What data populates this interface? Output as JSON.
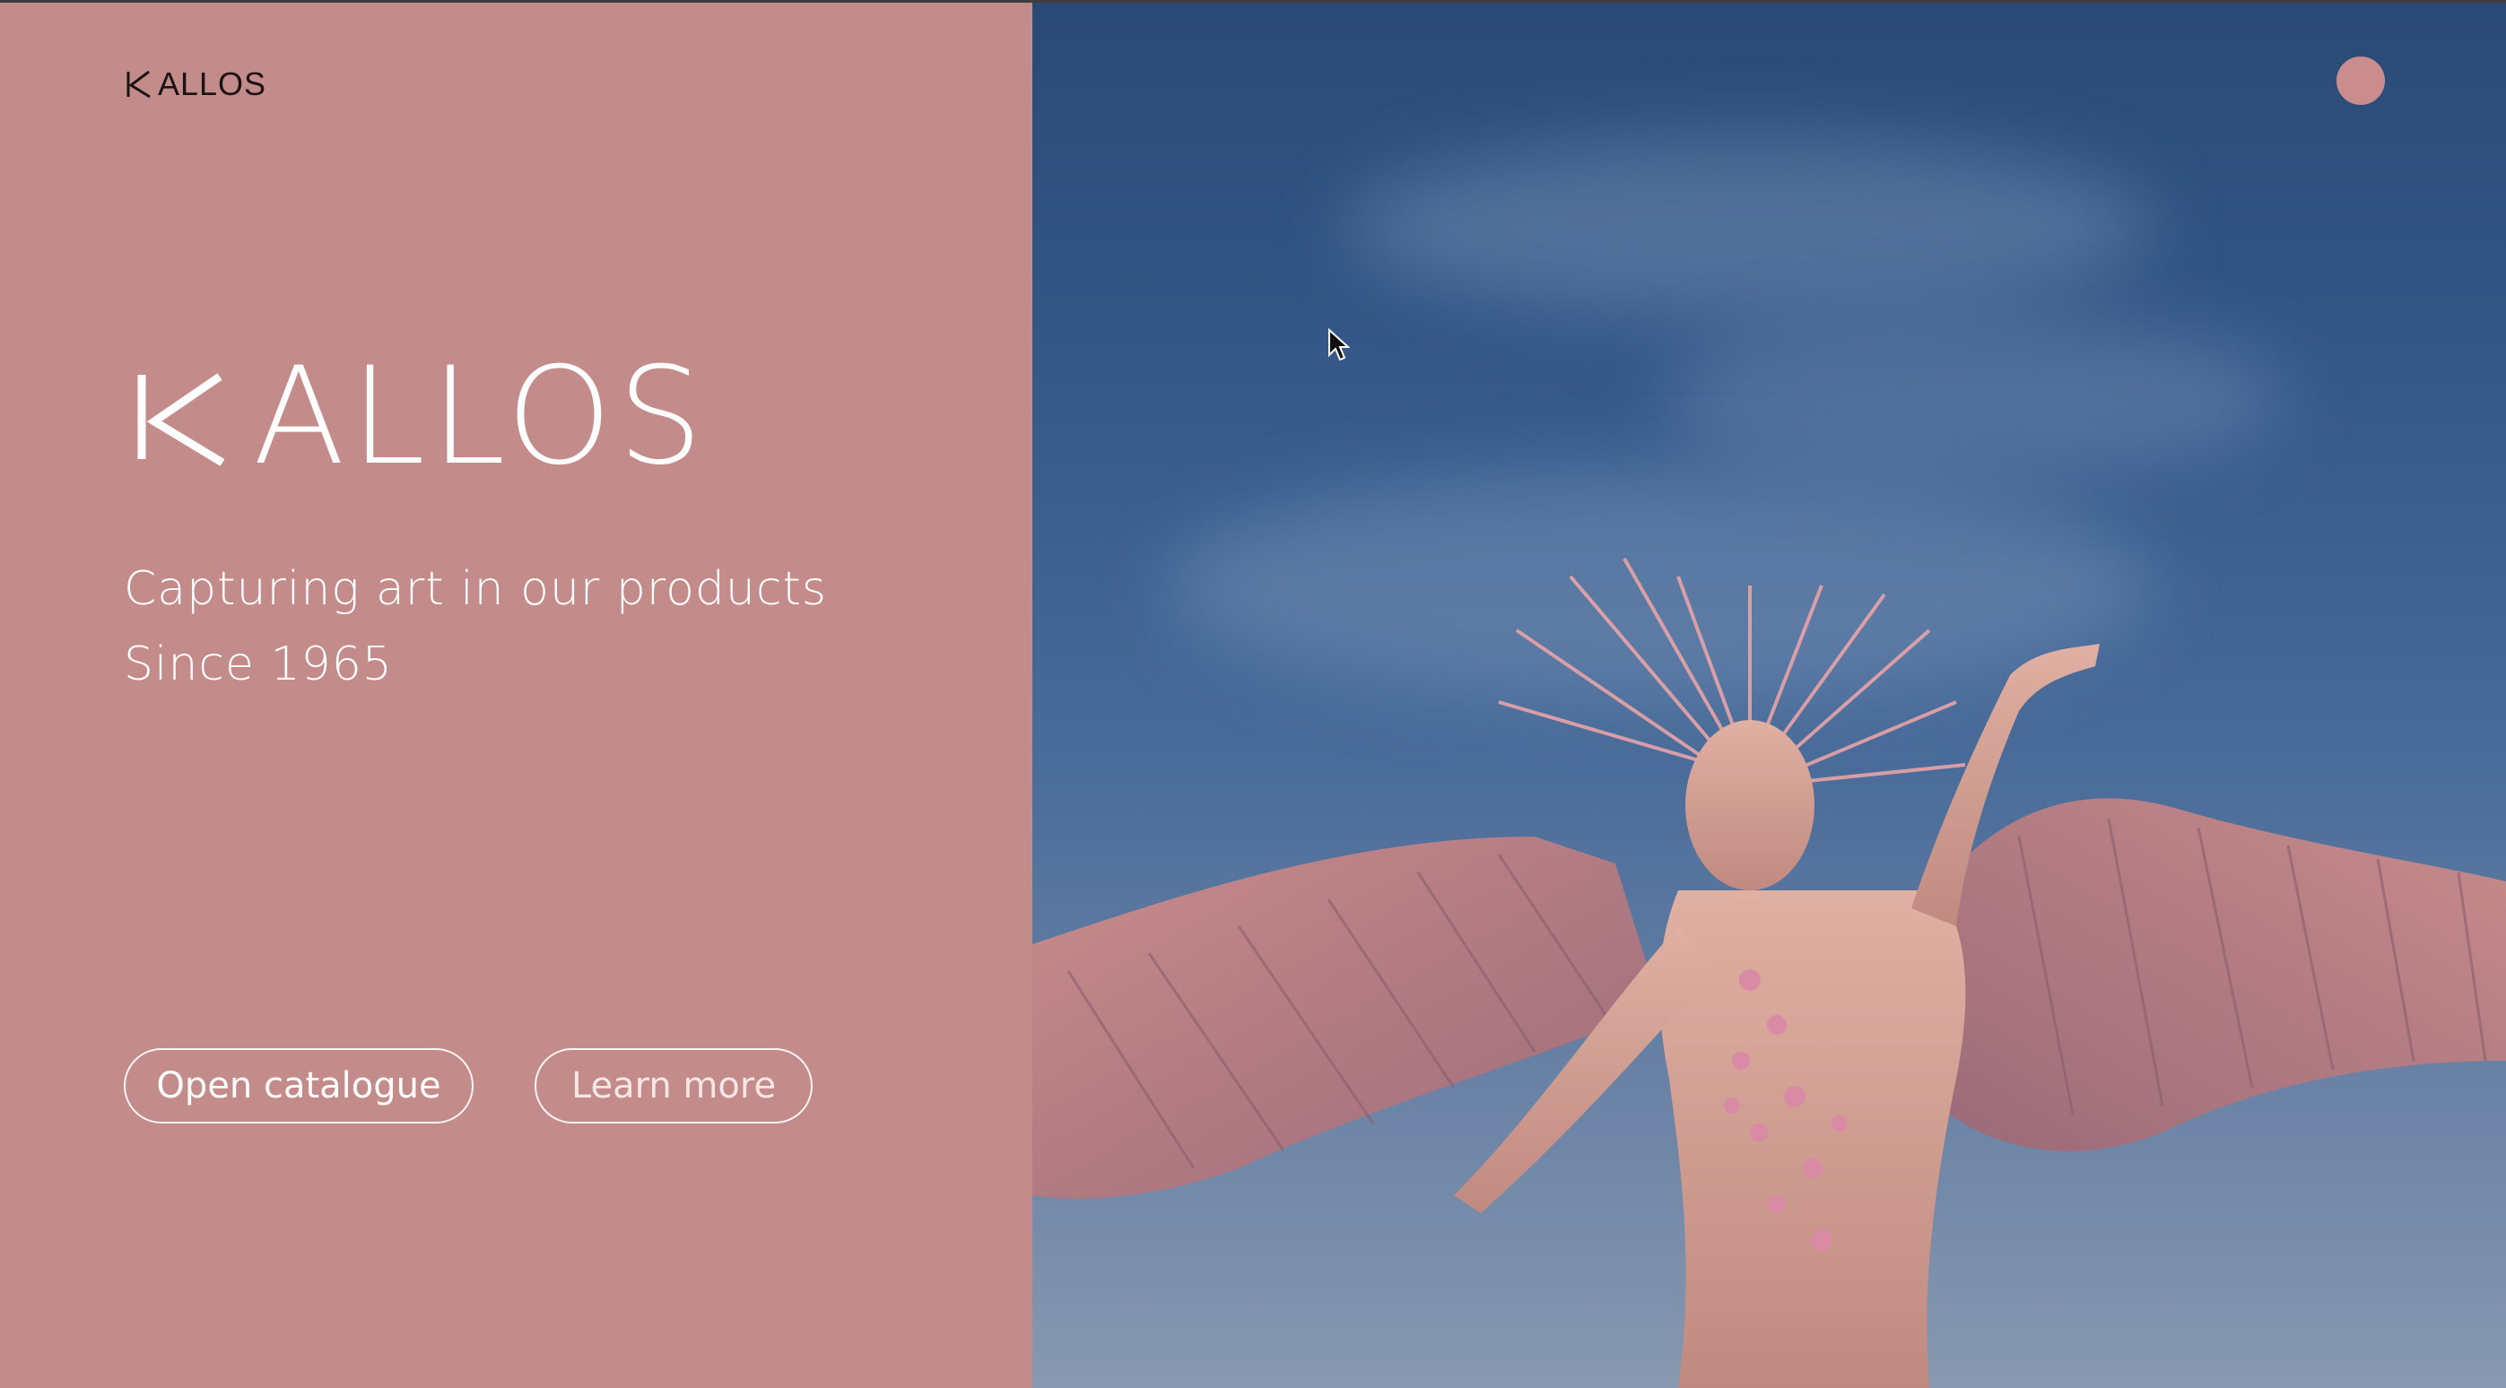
{
  "nav": {
    "logo_text": "ALLOS",
    "logo_icon": "k-mark-icon",
    "menu_icon": "circle-menu-icon"
  },
  "hero": {
    "logo_text": "ALLOS",
    "logo_icon": "k-mark-icon",
    "tagline_line1": "Capturing art in our products",
    "tagline_line2": "Since 1965"
  },
  "buttons": {
    "open_catalogue": "Open catalogue",
    "learn_more": "Learn more"
  },
  "colors": {
    "panel": "#c38c8a",
    "accent": "#cb8c8e",
    "text_light": "#ffffff",
    "text_dark": "#1c1414",
    "sky_top": "#2a4a75",
    "sky_bottom": "#8898b0"
  }
}
